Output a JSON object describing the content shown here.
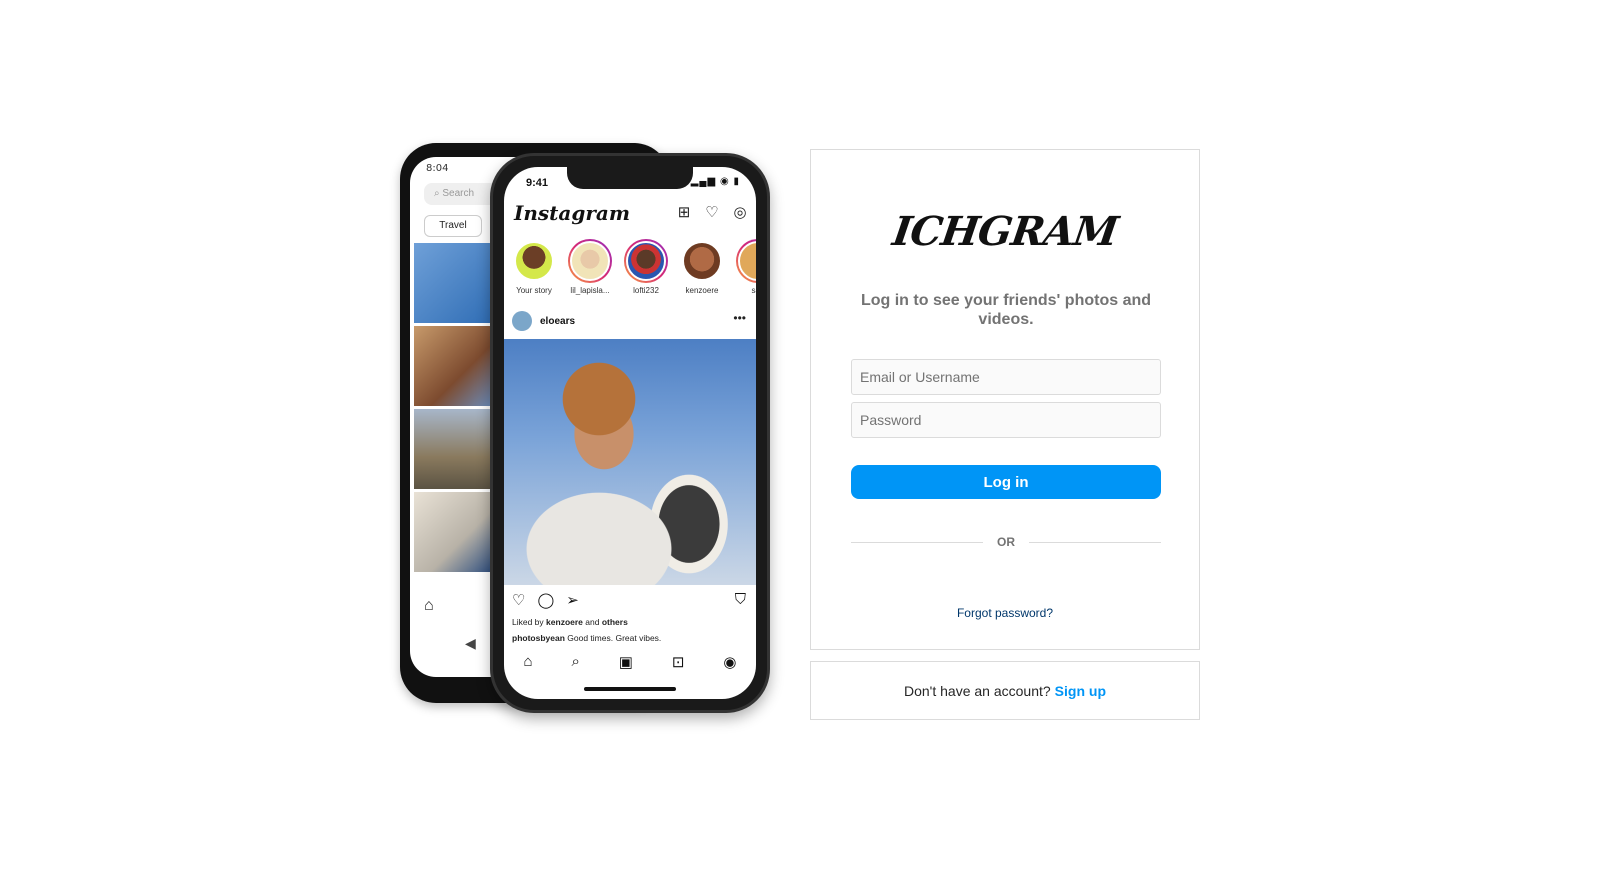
{
  "back_phone": {
    "time": "8:04",
    "search_placeholder": "Search",
    "chip": "Travel"
  },
  "front_phone": {
    "time": "9:41",
    "logo": "Instagram",
    "stories": [
      {
        "label": "Your story"
      },
      {
        "label": "lil_lapisla..."
      },
      {
        "label": "lofti232"
      },
      {
        "label": "kenzoere"
      },
      {
        "label": "sap"
      }
    ],
    "post_user": "eloears",
    "liked_prefix": "Liked by",
    "liked_user": "kenzoere",
    "liked_and": "and",
    "liked_others": "others",
    "caption_user": "photosbyean",
    "caption_text": "Good times. Great vibes."
  },
  "login": {
    "brand": "ICHGRAM",
    "tagline": "Log in to see your friends' photos and videos.",
    "email_placeholder": "Email or Username",
    "password_placeholder": "Password",
    "login_label": "Log in",
    "or_label": "OR",
    "forgot_label": "Forgot password?"
  },
  "signup": {
    "prompt": "Don't have an account?",
    "link": "Sign up"
  },
  "colors": {
    "accent": "#0095f6",
    "border": "#dbdbdb",
    "muted_text": "#737373",
    "link_dark": "#00376b"
  }
}
